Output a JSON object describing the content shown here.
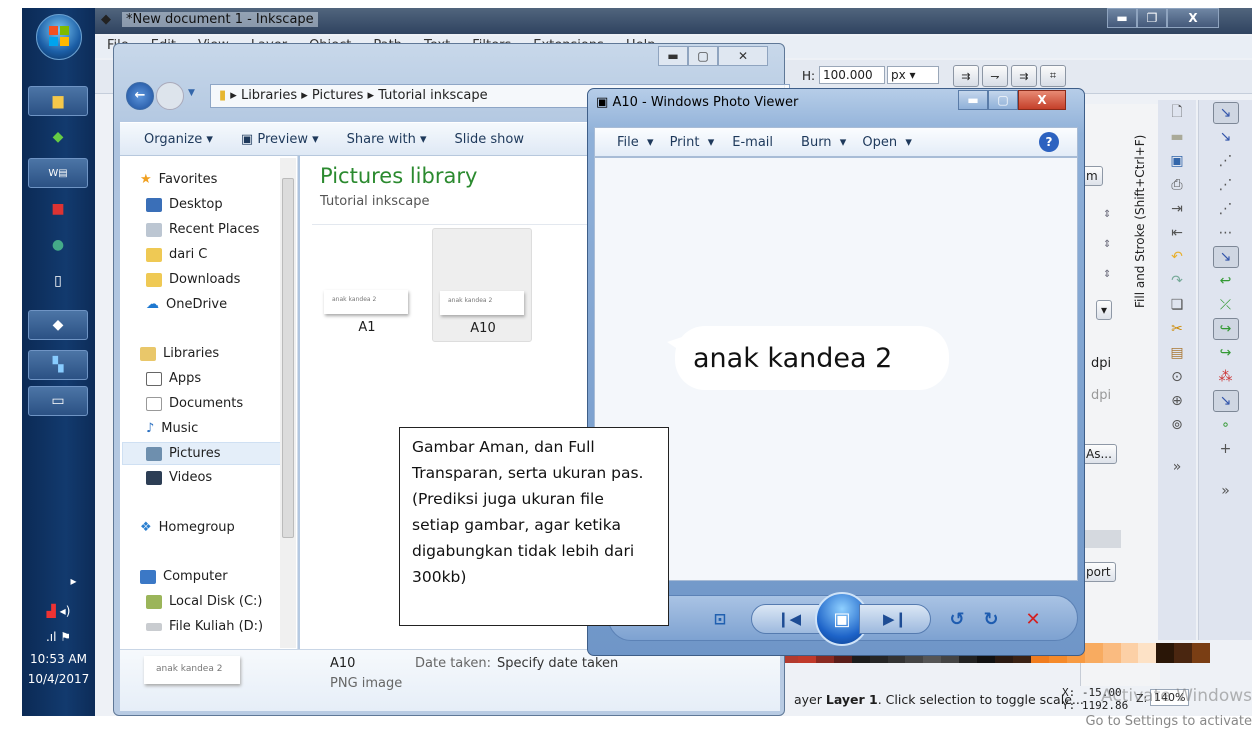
{
  "taskbar": {
    "time": "10:53 AM",
    "date": "10/4/2017"
  },
  "inkscape": {
    "title": "*New document 1 - Inkscape",
    "menu": [
      "File",
      "Edit",
      "View",
      "Layer",
      "Object",
      "Path",
      "Text",
      "Filters",
      "Extensions",
      "Help"
    ],
    "h_label": "H:",
    "h_value": "100.000",
    "unit": "px",
    "dock_vertical_tab": "Fill and Stroke (Shift+Ctrl+F)",
    "dock_buttons": {
      "m": "m",
      "export_as": "As...",
      "export": "port",
      "dpi1": "dpi",
      "dpi2": "dpi"
    },
    "status": {
      "message_pre": "ayer ",
      "layer": "Layer 1",
      "message_post": ". Click selection to toggle scale...",
      "x_label": "X:",
      "x": "-15.00",
      "y_label": "Y:",
      "y": "1192.86",
      "z_label": "Z:",
      "zoom": "140%"
    },
    "palette": [
      "#b33a2e",
      "#c0392b",
      "#8a2a22",
      "#5a1e1a",
      "#1c1c1c",
      "#262626",
      "#333",
      "#444",
      "#555",
      "#444",
      "#222",
      "#111",
      "#2a1a12",
      "#3b2214",
      "#f07c1e",
      "#f58a2a",
      "#f79a42",
      "#f8ab60",
      "#fabb80",
      "#fcd0a6",
      "#fde2c6",
      "#2a1607",
      "#4a2610",
      "#7a3e14"
    ]
  },
  "explorer": {
    "breadcrumb": [
      "Libraries",
      "Pictures",
      "Tutorial inkscape"
    ],
    "toolbar": [
      "Organize",
      "Preview",
      "Share with",
      "Slide show"
    ],
    "nav": {
      "favorites": "Favorites",
      "fav_items": [
        "Desktop",
        "Recent Places",
        "dari C",
        "Downloads",
        "OneDrive"
      ],
      "libraries": "Libraries",
      "lib_items": [
        "Apps",
        "Documents",
        "Music",
        "Pictures",
        "Videos"
      ],
      "homegroup": "Homegroup",
      "computer": "Computer",
      "comp_items": [
        "Local Disk (C:)",
        "File Kuliah (D:)"
      ]
    },
    "heading": "Pictures library",
    "subheading": "Tutorial inkscape",
    "files": [
      {
        "name": "A1",
        "thumb_text": "anak kandea 2"
      },
      {
        "name": "A10",
        "thumb_text": "anak kandea 2"
      }
    ],
    "details": {
      "name": "A10",
      "type": "PNG image",
      "date_label": "Date taken:",
      "date_value": "Specify date taken",
      "thumb_text": "anak kandea 2"
    }
  },
  "viewer": {
    "title": "A10 - Windows Photo Viewer",
    "menu": [
      "File",
      "Print",
      "E-mail",
      "Burn",
      "Open"
    ],
    "image_text": "anak kandea 2"
  },
  "note": "Gambar Aman, dan Full Transparan, serta ukuran pas. (Prediksi juga ukuran file setiap gambar, agar ketika digabungkan tidak lebih dari 300kb)",
  "watermark": {
    "line1": "Activate Windows",
    "line2": "Go to Settings to activate"
  }
}
